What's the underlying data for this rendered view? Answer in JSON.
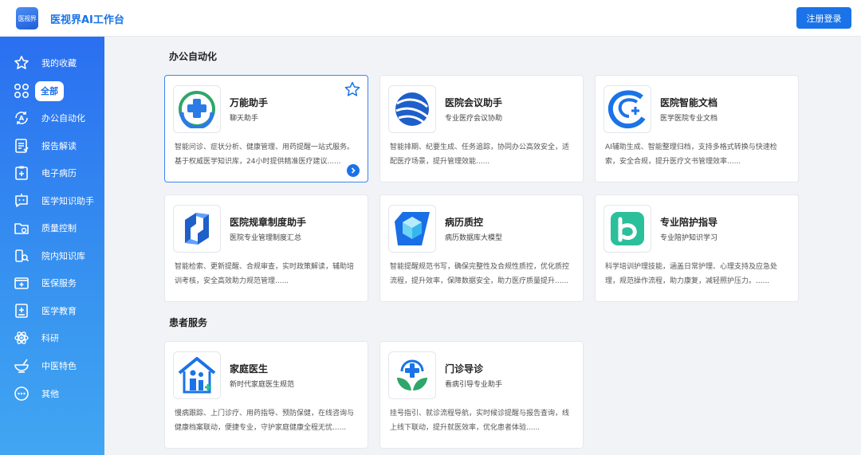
{
  "header": {
    "logo_text": "医视界",
    "brand": "医视界AI工作台",
    "login_label": "注册登录"
  },
  "sidebar": {
    "items": [
      {
        "label": "我的收藏",
        "icon": "star-icon"
      },
      {
        "label": "全部",
        "icon": "grid-icon"
      },
      {
        "label": "办公自动化",
        "icon": "office-automation-icon"
      },
      {
        "label": "报告解读",
        "icon": "report-icon"
      },
      {
        "label": "电子病历",
        "icon": "medical-record-icon"
      },
      {
        "label": "医学知识助手",
        "icon": "chat-bot-icon"
      },
      {
        "label": "质量控制",
        "icon": "quality-folder-icon"
      },
      {
        "label": "院内知识库",
        "icon": "knowledge-base-icon"
      },
      {
        "label": "医保服务",
        "icon": "insurance-icon"
      },
      {
        "label": "医学教育",
        "icon": "education-icon"
      },
      {
        "label": "科研",
        "icon": "atom-icon"
      },
      {
        "label": "中医特色",
        "icon": "mortar-icon"
      },
      {
        "label": "其他",
        "icon": "more-icon"
      }
    ]
  },
  "sections": [
    {
      "title": "办公自动化",
      "cards": [
        {
          "title": "万能助手",
          "subtitle": "聊天助手",
          "desc": "智能问诊、症状分析、健康管理、用药提醒一站式服务。基于权威医学知识库，24小时提供精准医疗建议......",
          "icon": "medical-cross-icon"
        },
        {
          "title": "医院会议助手",
          "subtitle": "专业医疗会议协助",
          "desc": "智能排期、纪要生成、任务追踪，协同办公高效安全，适配医疗场景，提升管理效能......",
          "icon": "globe-swirl-icon"
        },
        {
          "title": "医院智能文档",
          "subtitle": "医学医院专业文档",
          "desc": "AI辅助生成、智能整理归档，支持多格式转换与快速检索，安全合规，提升医疗文书管理效率......",
          "icon": "document-swirl-icon"
        },
        {
          "title": "医院规章制度助手",
          "subtitle": "医院专业管理制度汇总",
          "desc": "智能检索、更新提醒、合规审查，实时政策解读，辅助培训考核，安全高效助力规范管理......",
          "icon": "regulation-cube-icon"
        },
        {
          "title": "病历质控",
          "subtitle": "病历数据库大模型",
          "desc": "智能提醒规范书写，确保完整性及合规性质控，优化质控流程，提升效率，保障数据安全，助力医疗质量提升......",
          "icon": "hexagon-cube-icon"
        },
        {
          "title": "专业陪护指导",
          "subtitle": "专业陪护知识学习",
          "desc": "科学培训护理技能，涵盖日常护理、心理支持及应急处理，规范操作流程，助力康复，减轻照护压力。......",
          "icon": "care-letter-icon"
        }
      ]
    },
    {
      "title": "患者服务",
      "cards": [
        {
          "title": "家庭医生",
          "subtitle": "新时代家庭医生规范",
          "desc": "慢病跟踪、上门诊疗、用药指导、预防保健，在线咨询与健康档案联动，便捷专业，守护家庭健康全程无忧......",
          "icon": "family-house-icon"
        },
        {
          "title": "门诊导诊",
          "subtitle": "看病引导专业助手",
          "desc": "挂号指引、就诊流程导航，实时候诊提醒与报告查询，线上线下联动，提升就医效率，优化患者体验......",
          "icon": "cross-leaf-icon"
        }
      ]
    }
  ],
  "colors": {
    "accent": "#1a73e8",
    "sidebar_top": "#2a6ff0",
    "sidebar_bottom": "#41a6f2",
    "background": "#f2f3f6",
    "active_card_border": "#3b86f2"
  }
}
